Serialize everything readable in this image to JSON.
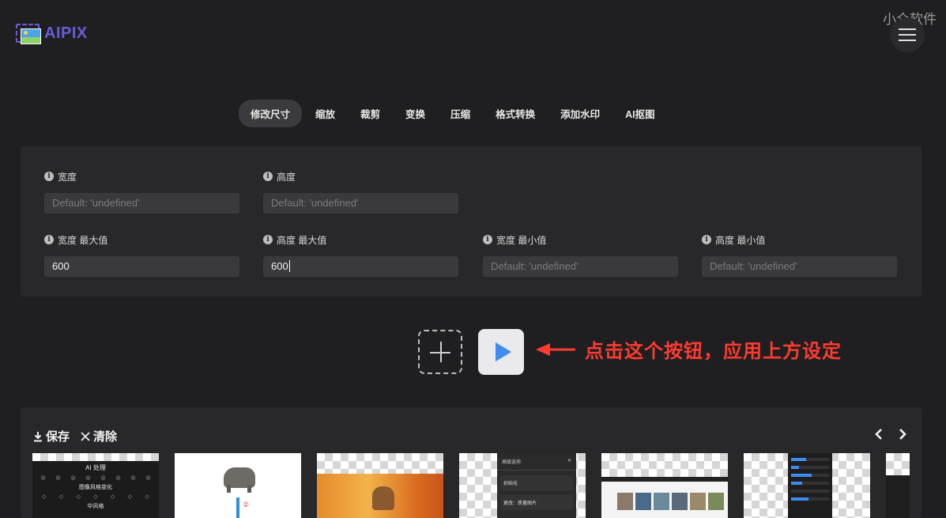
{
  "app": {
    "logo_text": "AIPIX"
  },
  "watermark": "小众软件",
  "tabs": [
    {
      "label": "修改尺寸",
      "active": true
    },
    {
      "label": "缩放",
      "active": false
    },
    {
      "label": "裁剪",
      "active": false
    },
    {
      "label": "变换",
      "active": false
    },
    {
      "label": "压缩",
      "active": false
    },
    {
      "label": "格式转换",
      "active": false
    },
    {
      "label": "添加水印",
      "active": false
    },
    {
      "label": "AI抠图",
      "active": false
    }
  ],
  "fields": {
    "width": {
      "label": "宽度",
      "placeholder": "Default: 'undefined'"
    },
    "height": {
      "label": "高度",
      "placeholder": "Default: 'undefined'"
    },
    "max_width": {
      "label": "宽度 最大值",
      "value": "600"
    },
    "max_height": {
      "label": "高度 最大值",
      "value": "600"
    },
    "min_width": {
      "label": "宽度 最小值",
      "placeholder": "Default: 'undefined'"
    },
    "min_height": {
      "label": "高度 最小值",
      "placeholder": "Default: 'undefined'"
    }
  },
  "annotation": "点击这个按钮，应用上方设定",
  "gallery": {
    "save_label": "保存",
    "clear_label": "清除",
    "thumb1": {
      "title": "AI 处理",
      "subtitle": "图像风格变化",
      "footer": "中风格"
    },
    "thumb2": {
      "marker": "②"
    },
    "thumb4": {
      "header": "高级选项",
      "item1": "初始化",
      "item2": "更改：质量图片"
    }
  },
  "colors": {
    "accent": "#3d8df0",
    "annotation": "#ff3b30",
    "logo": "#6b5bd6",
    "background": "#1f1f21",
    "panel": "#28282b"
  }
}
